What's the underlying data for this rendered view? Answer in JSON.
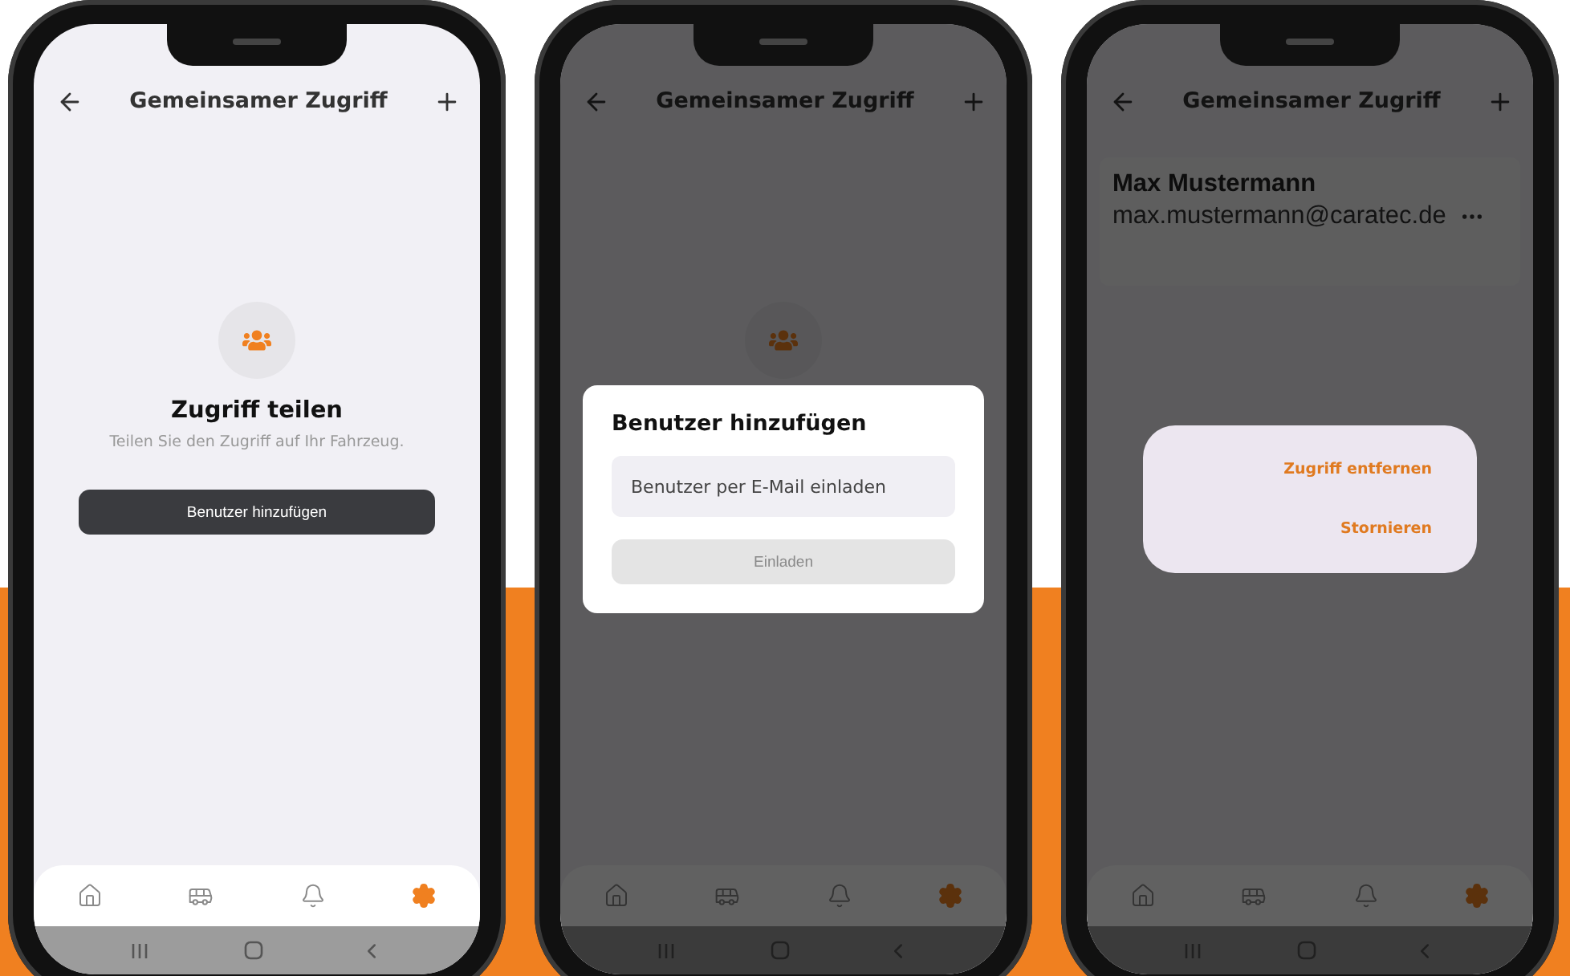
{
  "phones": [
    {
      "header": {
        "title": "Gemeinsamer Zugriff"
      },
      "content": {
        "kind": "empty_state",
        "title": "Zugriff teilen",
        "text": "Teilen Sie den Zugriff auf Ihr Fahrzeug.",
        "button": "Benutzer hinzufügen"
      },
      "tab_bar": [
        {
          "selected": false
        },
        {
          "selected": false
        },
        {
          "selected": false
        },
        {
          "selected": true
        }
      ]
    },
    {
      "header": {
        "title": "Gemeinsamer Zugriff"
      },
      "content": {
        "kind": "empty_icon"
      },
      "dialog": {
        "kind": "invite",
        "title": "Benutzer hinzufügen",
        "placeholder": "Benutzer per E-Mail einladen",
        "button": "Einladen",
        "disabled": true
      },
      "tab_bar": [
        {
          "selected": false
        },
        {
          "selected": false
        },
        {
          "selected": false
        },
        {
          "selected": true
        }
      ]
    },
    {
      "header": {
        "title": "Gemeinsamer Zugriff"
      },
      "content": {
        "kind": "users",
        "users": [
          {
            "name": "Max Mustermann",
            "email": "max.mustermann@caratec.de"
          }
        ]
      },
      "dialog": {
        "kind": "actions",
        "actions": [
          "Zugriff entfernen",
          "Stornieren"
        ]
      },
      "tab_bar": [
        {
          "selected": false
        },
        {
          "selected": false
        },
        {
          "selected": false
        },
        {
          "selected": true
        }
      ]
    }
  ]
}
